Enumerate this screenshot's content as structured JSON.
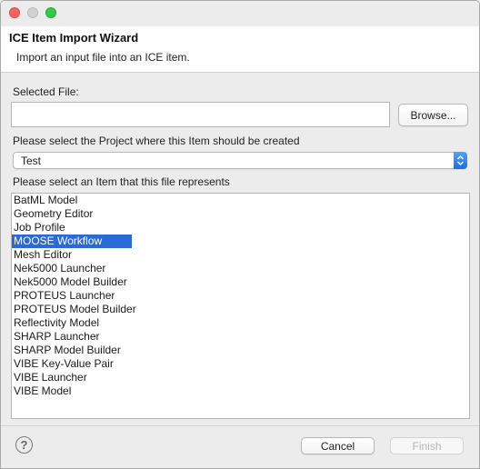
{
  "window": {
    "title": "ICE Item Import Wizard",
    "description": "Import an input file into an ICE item."
  },
  "file": {
    "label": "Selected File:",
    "value": "",
    "browse_label": "Browse..."
  },
  "project": {
    "label": "Please select the Project where this Item should be created",
    "selected": "Test"
  },
  "items": {
    "label": "Please select an Item that this file represents",
    "list": [
      "BatML Model",
      "Geometry Editor",
      "Job Profile",
      "MOOSE Workflow",
      "Mesh Editor",
      "Nek5000 Launcher",
      "Nek5000 Model Builder",
      "PROTEUS Launcher",
      "PROTEUS Model Builder",
      "Reflectivity Model",
      "SHARP Launcher",
      "SHARP Model Builder",
      "VIBE Key-Value Pair",
      "VIBE Launcher",
      "VIBE Model"
    ],
    "selected": "MOOSE Workflow"
  },
  "footer": {
    "help_icon": "?",
    "cancel_label": "Cancel",
    "finish_label": "Finish"
  },
  "colors": {
    "selection": "#2a6ad8",
    "close_light": "#fc605c",
    "min_light": "#d1d1d1",
    "max_light": "#34c84a"
  }
}
